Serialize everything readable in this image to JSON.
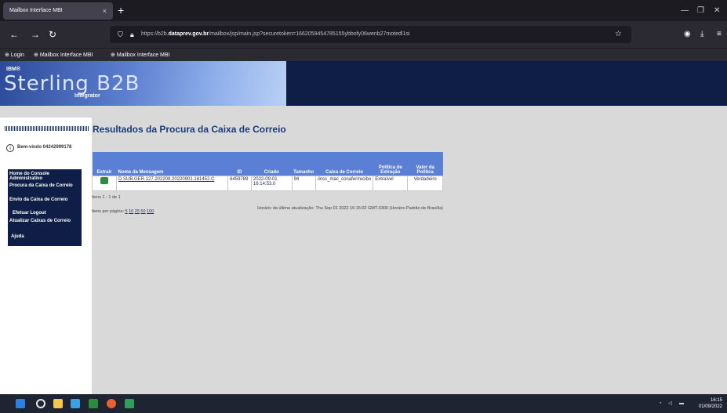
{
  "browser": {
    "tab_title": "Mailbox Interface MBI",
    "tab_close": "×",
    "new_tab": "+",
    "url_prefix": "https://b2b.",
    "url_domain": "dataprev.gov.br",
    "url_rest": "/mailbox/jsp/main.jsp?securetoken=1662059454785155ybbofy06wenb27motedl1si",
    "bookmarks": [
      "Login",
      "Mailbox Interface MBI",
      "Mailbox Interface MBI"
    ]
  },
  "banner": {
    "ibm": "IBM®",
    "product": "Sterling B2B",
    "sub": "Integrator"
  },
  "sidebar": {
    "welcome": "Bem-vindo 04242999178",
    "menu": [
      "Home do Console Administrativo",
      "Procura da Caixa de Correio",
      "Envio da Caixa de Correio",
      "Efetuar Logout",
      "Atualizar Caixas de Correio",
      "Ajuda"
    ]
  },
  "content": {
    "title": "Resultados da Procura da Caixa de Correio",
    "columns": [
      "Extrair",
      "Nome da Mensagem",
      "ID",
      "Criado",
      "Tamanho",
      "Caixa de Correio",
      "Política de Extração",
      "Valor da Política"
    ],
    "rows": [
      {
        "name": "D.SUB.GER.127.202208.20220901.161452.C",
        "id": "6459789",
        "created": "2022-09-01 16:14:53.0",
        "size": "94",
        "mailbox": "/inss_mac_conafer/recibo",
        "policy": "Extraível",
        "value": "Verdadeiro"
      }
    ],
    "items_count": "Itens 1 - 1 de 1",
    "per_page_label": "Itens por página:",
    "per_page_options": [
      "5",
      "10",
      "25",
      "50",
      "100"
    ],
    "last_update": "Horário da última atualização: Thu Sep 01 2022 16:15:02 GMT-0300 (Horário Padrão de Brasília)"
  },
  "taskbar": {
    "time": "16:15",
    "date": "01/09/2022"
  }
}
